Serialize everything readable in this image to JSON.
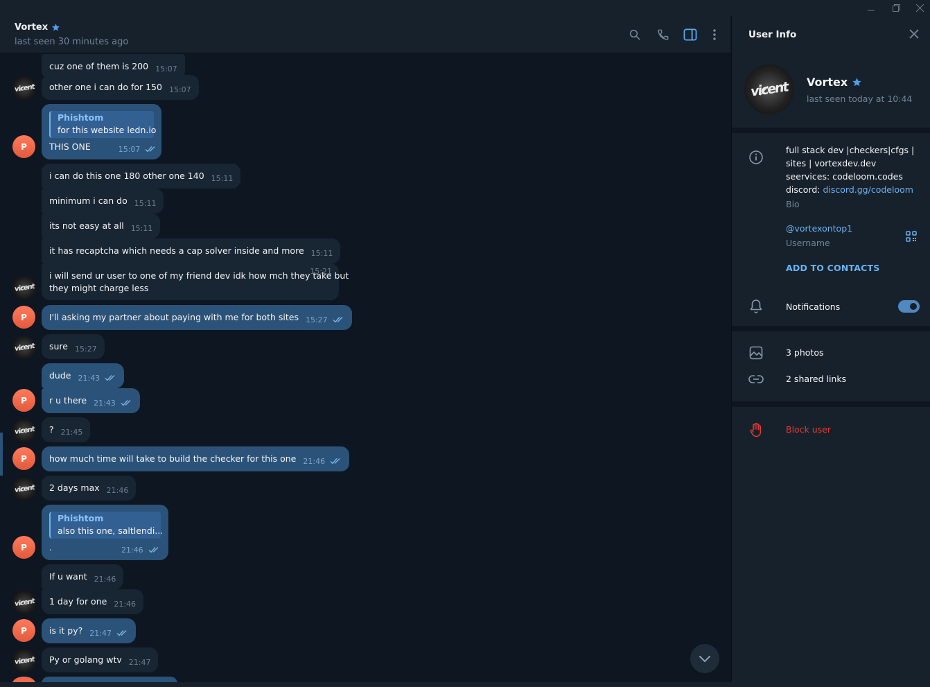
{
  "window": {
    "minimize_icon": "minimize-icon",
    "restore_icon": "restore-icon",
    "close_icon": "close-icon"
  },
  "chat_header": {
    "name": "Vortex",
    "status": "last seen 30 minutes ago",
    "icons": [
      "search-icon",
      "phone-icon",
      "sidebar-toggle-icon",
      "more-vertical-icon"
    ]
  },
  "colors": {
    "accent": "#6ab3f3",
    "outgoing_bubble": "#2b5278",
    "incoming_bubble": "#182533",
    "background": "#0e1621",
    "panel": "#17212b",
    "danger": "#e53935"
  },
  "avatar_texts": {
    "vortex": "vic̷ent",
    "partner_initial": "P"
  },
  "messages": [
    {
      "text": "cuz one of them is 200",
      "time": "15:07"
    },
    {
      "text": "other one i can do for 150",
      "time": "15:07"
    },
    {
      "reply_name": "Phishtom",
      "reply_text": "for this website ledn.io",
      "text": "THIS ONE",
      "time": "15:07"
    },
    {
      "text": "i can do this one 180 other one 140",
      "time": "15:11"
    },
    {
      "text": "minimum i can do",
      "time": "15:11"
    },
    {
      "text": "its not easy at all",
      "time": "15:11"
    },
    {
      "text": "it has recaptcha which needs a cap solver inside and more",
      "time": "15:11"
    },
    {
      "text": "i will send ur user to one of my friend dev idk how mch they take but",
      "text2": "they might charge less",
      "time": "15:21"
    },
    {
      "text": "I'll asking my partner about paying with me for both sites",
      "time": "15:27"
    },
    {
      "text": "sure",
      "time": "15:27"
    },
    {
      "text": "dude",
      "time": "21:43"
    },
    {
      "text": "r u there",
      "time": "21:43"
    },
    {
      "text": "?",
      "time": "21:45"
    },
    {
      "text": "how much time will take to build the checker for this one",
      "time": "21:46"
    },
    {
      "text": "2 days max",
      "time": "21:46"
    },
    {
      "reply_name": "Phishtom",
      "reply_text": "also this one, saltlendi...",
      "text": ".",
      "time": "21:46"
    },
    {
      "text": "If u want",
      "time": "21:46"
    },
    {
      "text": "1 day for one",
      "time": "21:46"
    },
    {
      "text": "is it py?",
      "time": "21:47"
    },
    {
      "text": "Py or golang wtv",
      "time": "21:47"
    }
  ],
  "user_info": {
    "title": "User Info",
    "name": "Vortex",
    "last_seen": "last seen today at 10:44",
    "bio_line1": "full stack dev |checkers|cfgs |",
    "bio_line2": "sites | vortexdev.dev",
    "bio_line3": "seervices: codeloom.codes",
    "bio_line4_prefix": "discord: ",
    "bio_link": "discord.gg/codeloom",
    "bio_label": "Bio",
    "username": "@vortexontop1",
    "username_label": "Username",
    "add_contacts": "ADD TO CONTACTS",
    "notifications": "Notifications",
    "notifications_on": true,
    "photos": "3 photos",
    "shared_links": "2 shared links",
    "block": "Block user"
  }
}
